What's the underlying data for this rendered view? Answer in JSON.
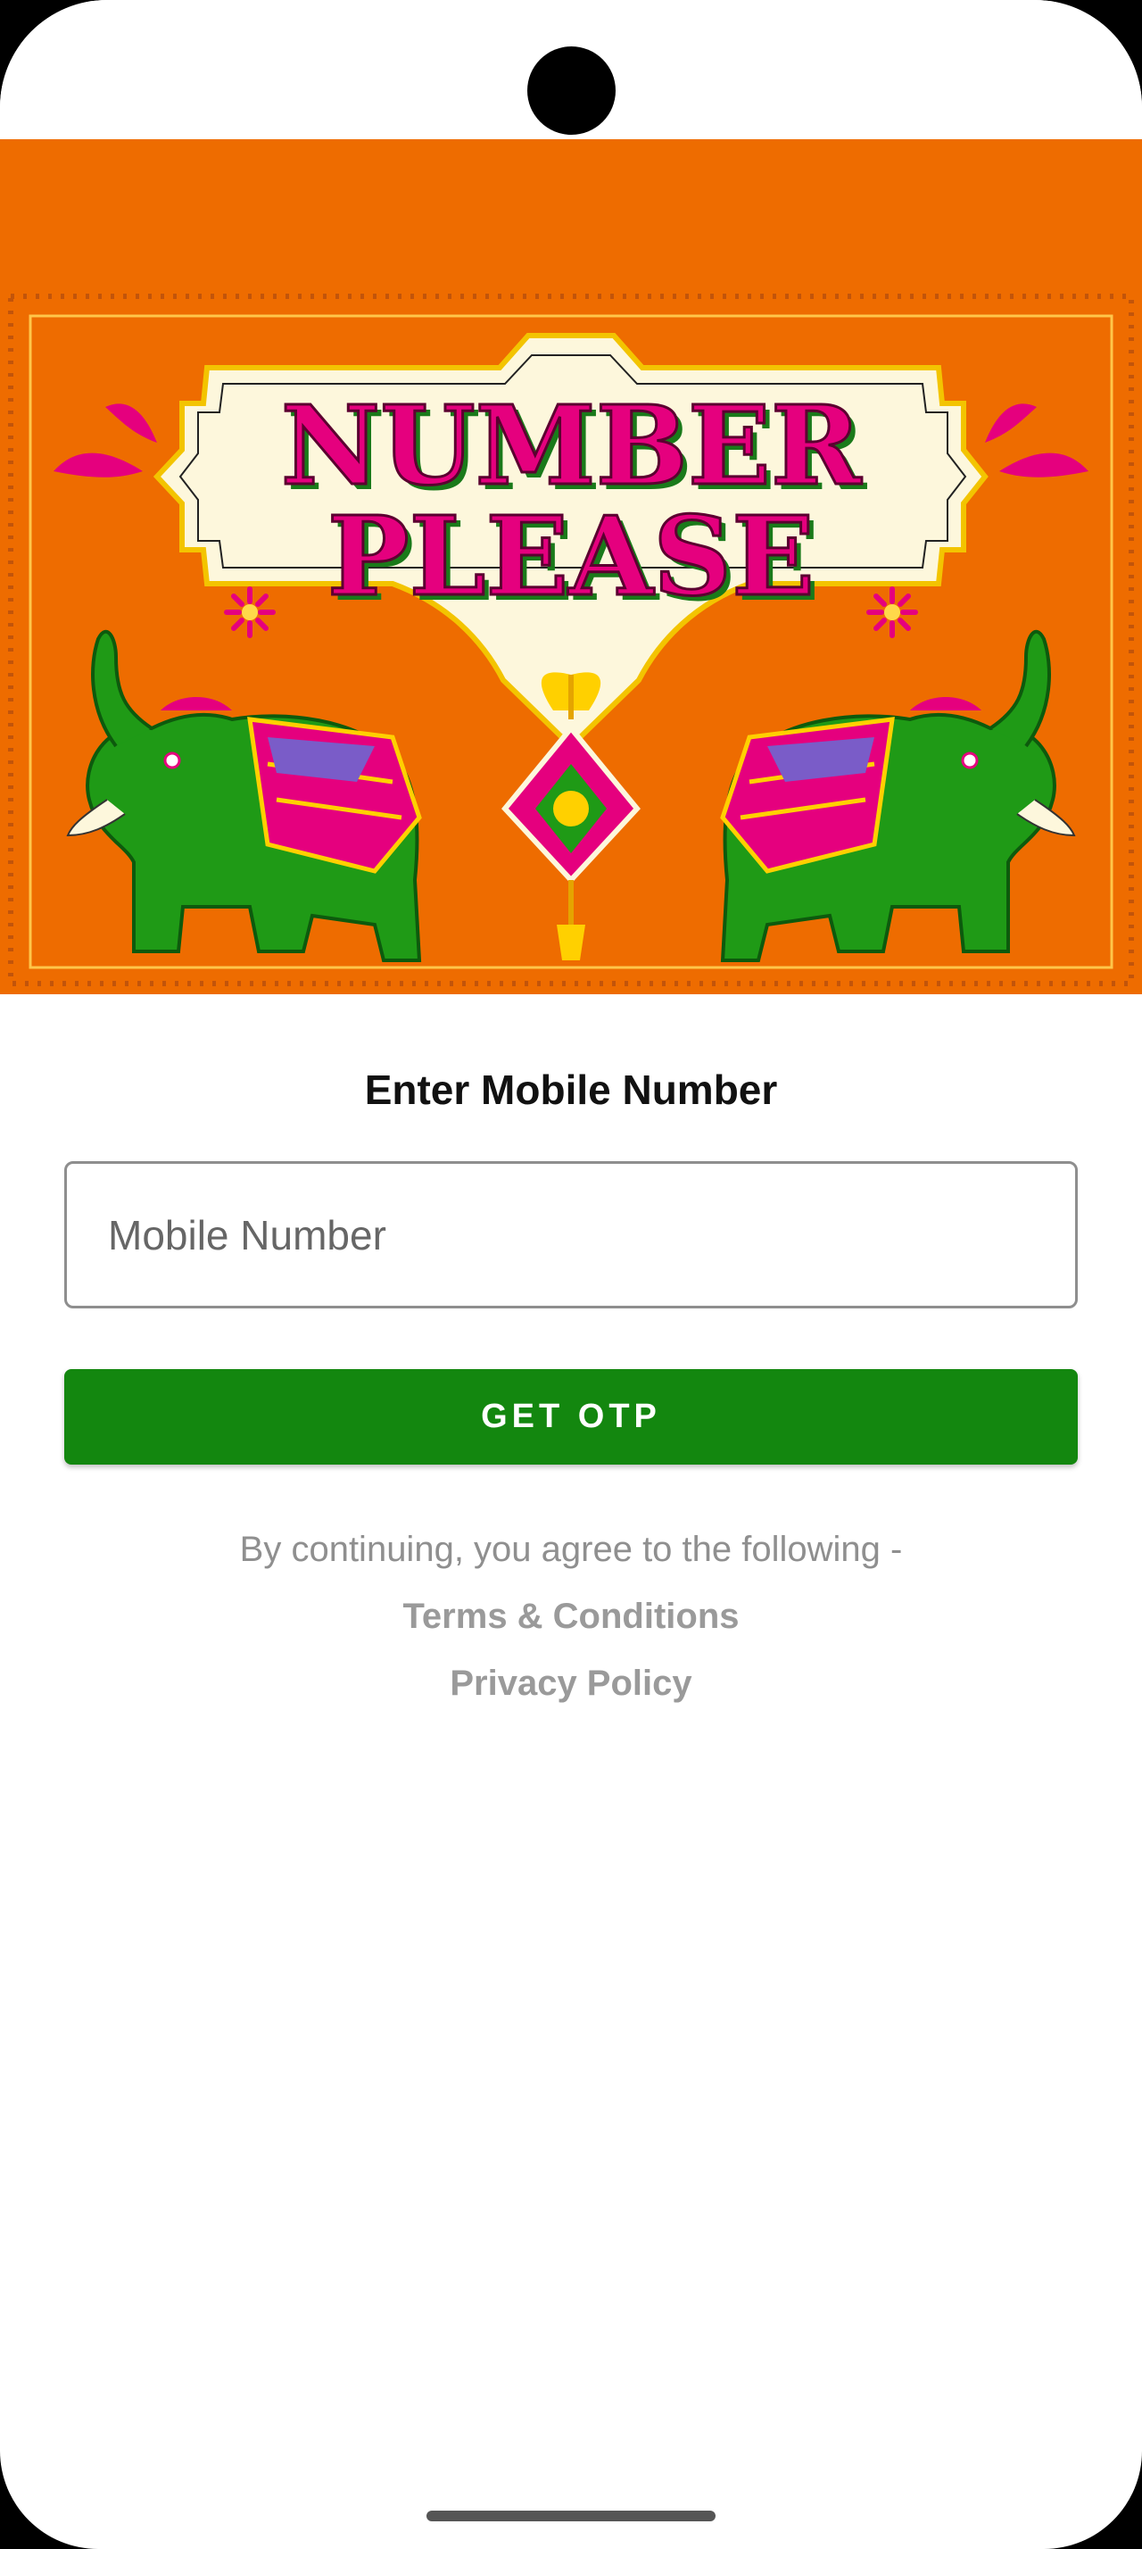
{
  "banner": {
    "title_line1": "NUMBER",
    "title_line2": "PLEASE"
  },
  "login": {
    "heading": "Enter Mobile Number",
    "mobile_placeholder": "Mobile Number",
    "mobile_value": "",
    "otp_button_label": "GET OTP",
    "agree_text": "By continuing, you agree to the following -",
    "terms_label": "Terms & Conditions",
    "privacy_label": "Privacy Policy"
  },
  "colors": {
    "banner_orange": "#ee6c00",
    "button_green": "#13870f",
    "title_pink": "#e5007e",
    "elephant_green": "#1f9a16",
    "frame_cream": "#fdf7dc"
  },
  "icons": [
    "elephant-left-icon",
    "elephant-right-icon",
    "flower-icon",
    "tassel-ornament-icon"
  ]
}
